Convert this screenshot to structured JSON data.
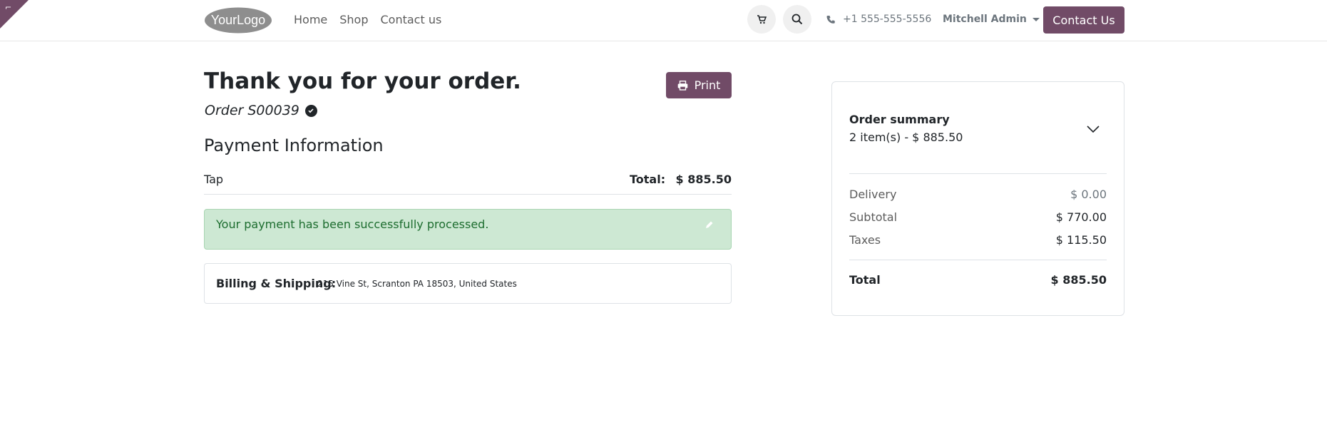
{
  "header": {
    "logo_alt": "YourLogo",
    "nav": [
      "Home",
      "Shop",
      "Contact us"
    ],
    "phone": "+1 555-555-5556",
    "user": "Mitchell Admin",
    "contact_button": "Contact Us"
  },
  "main": {
    "title": "Thank you for your order.",
    "order_ref": "Order S00039",
    "print_label": "Print",
    "payment_heading": "Payment Information",
    "payment_method": "Tap",
    "total_label": "Total:",
    "total_value": "$ 885.50",
    "alert_message": "Your payment has been successfully processed.",
    "billing_label": "Billing & Shipping:",
    "billing_address": "215 Vine St, Scranton PA 18503, United States"
  },
  "summary": {
    "title": "Order summary",
    "count": "2 item(s) -  $ 885.50",
    "rows": [
      {
        "label": "Delivery",
        "value": "$ 0.00"
      },
      {
        "label": "Subtotal",
        "value": "$ 770.00"
      },
      {
        "label": "Taxes",
        "value": "$ 115.50"
      }
    ],
    "total_label": "Total",
    "total_value": "$ 885.50"
  },
  "colors": {
    "brand": "#714b67",
    "success_bg": "#cde8d3",
    "success_text": "#1d6d2f"
  }
}
